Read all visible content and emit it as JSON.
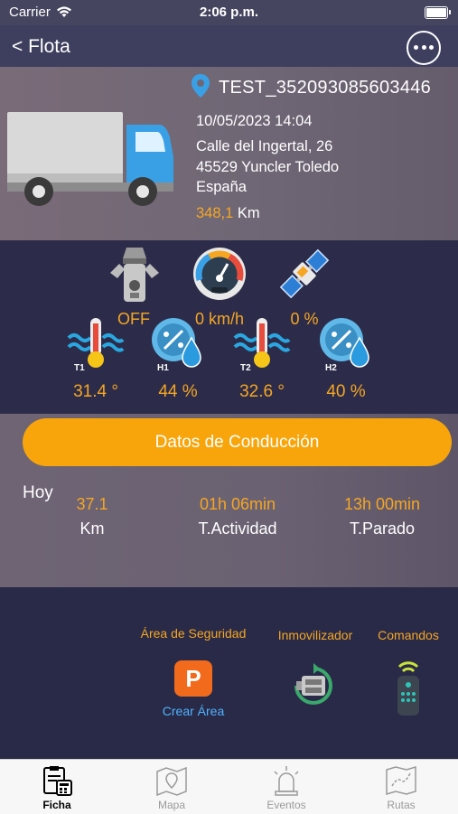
{
  "status_bar": {
    "carrier": "Carrier",
    "time": "2:06 p.m."
  },
  "nav": {
    "back_label": "< Flota",
    "more_icon": "more-icon"
  },
  "vehicle": {
    "name": "TEST_352093085603446",
    "datetime": "10/05/2023 14:04",
    "address_line1": "Calle del Ingertal, 26",
    "address_line2": "45529 Yuncler Toledo",
    "country": "España",
    "odometer_value": "348,1",
    "odometer_unit": "Km"
  },
  "sensors": {
    "ignition": "OFF",
    "speed": "0 km/h",
    "gps": "0 %",
    "t1_label": "T1",
    "t1": "31.4 °",
    "h1_label": "H1",
    "h1": "44 %",
    "t2_label": "T2",
    "t2": "32.6 °",
    "h2_label": "H2",
    "h2": "40 %"
  },
  "driving": {
    "button_label": "Datos de Conducción",
    "period": "Hoy",
    "km_value": "37.1",
    "km_label": "Km",
    "activity_value": "01h 06min",
    "activity_label": "T.Actividad",
    "stopped_value": "13h 00min",
    "stopped_label": "T.Parado"
  },
  "controls": {
    "security_label": "Área de Seguridad",
    "create_area_label": "Crear Área",
    "immobilizer_label": "Inmovilizador",
    "commands_label": "Comandos",
    "parking_letter": "P"
  },
  "tabs": [
    {
      "label": "Ficha",
      "icon": "ficha-icon",
      "active": true
    },
    {
      "label": "Mapa",
      "icon": "map-icon",
      "active": false
    },
    {
      "label": "Eventos",
      "icon": "alarm-icon",
      "active": false
    },
    {
      "label": "Rutas",
      "icon": "routes-icon",
      "active": false
    }
  ],
  "colors": {
    "accent": "#f7a50b",
    "link": "#4fb3ff"
  }
}
